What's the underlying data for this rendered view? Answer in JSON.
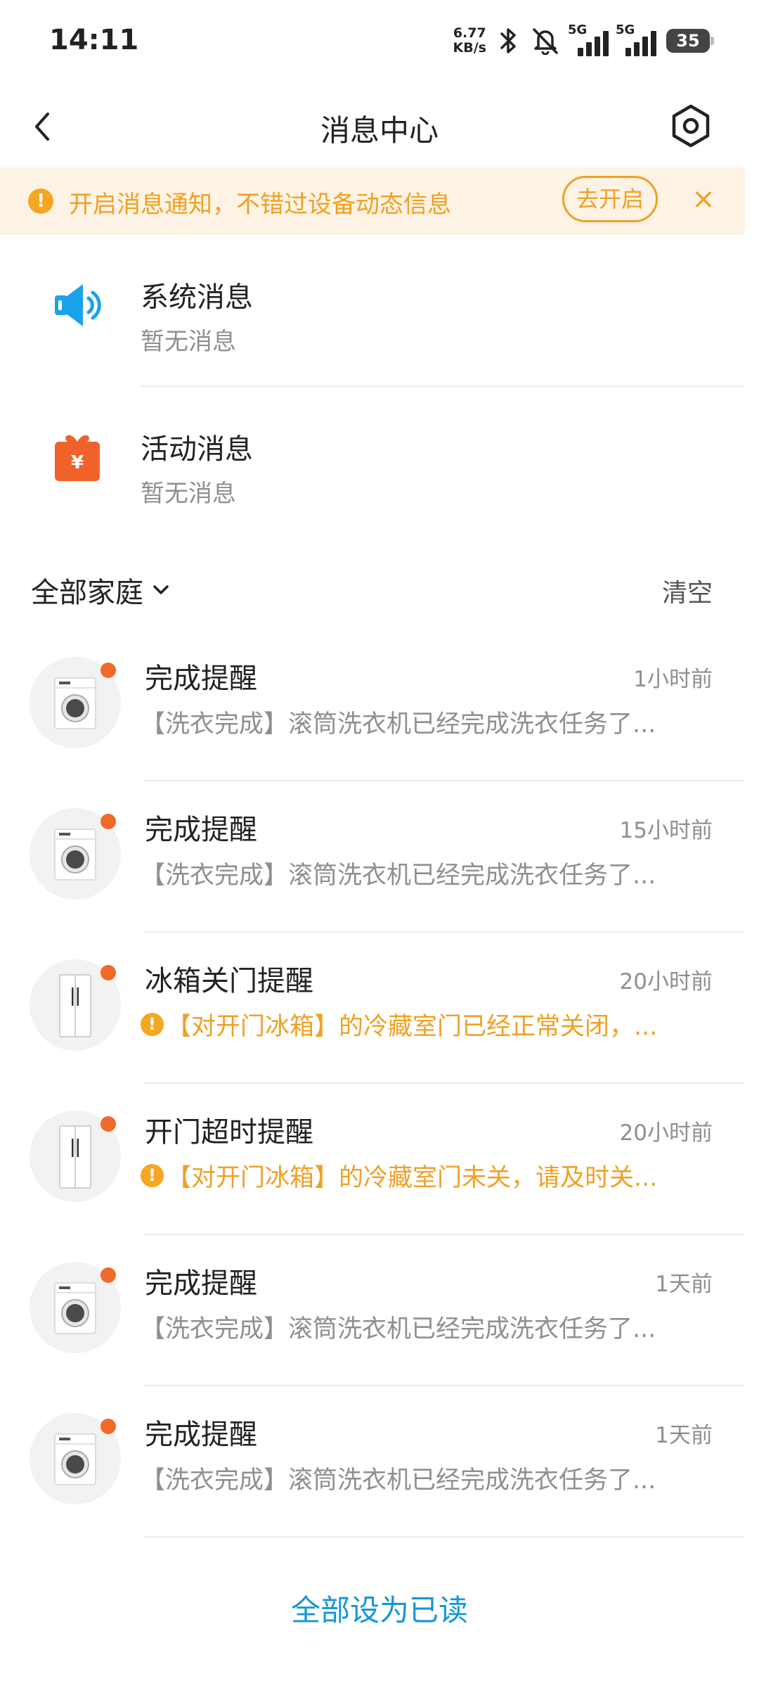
{
  "status_bar": {
    "time": "14:11",
    "net_speed_value": "6.77",
    "net_speed_unit": "KB/s",
    "sim1": "5G",
    "sim2": "5G",
    "battery": "35"
  },
  "header": {
    "title": "消息中心",
    "back_icon": "chevron-left-icon",
    "settings_icon": "hexagon-gear-icon"
  },
  "notify_banner": {
    "text": "开启消息通知，不错过设备动态信息",
    "enable_label": "去开启",
    "close_label": "×",
    "accent": "#f0a024",
    "background": "#fdf3e4"
  },
  "categories": [
    {
      "title": "系统消息",
      "subtitle": "暂无消息",
      "icon": "speaker-icon"
    },
    {
      "title": "活动消息",
      "subtitle": "暂无消息",
      "icon": "gift-icon",
      "icon_text": "¥"
    }
  ],
  "filter": {
    "family_label": "全部家庭",
    "clear_label": "清空"
  },
  "messages": [
    {
      "title": "完成提醒",
      "time": "1小时前",
      "preview": "【洗衣完成】滚筒洗衣机已经完成洗衣任务了...",
      "device": "washing-machine-icon",
      "unread": true,
      "warning": false
    },
    {
      "title": "完成提醒",
      "time": "15小时前",
      "preview": "【洗衣完成】滚筒洗衣机已经完成洗衣任务了...",
      "device": "washing-machine-icon",
      "unread": true,
      "warning": false
    },
    {
      "title": "冰箱关门提醒",
      "time": "20小时前",
      "preview": "【对开门冰箱】的冷藏室门已经正常关闭，...",
      "device": "fridge-icon",
      "unread": true,
      "warning": true
    },
    {
      "title": "开门超时提醒",
      "time": "20小时前",
      "preview": "【对开门冰箱】的冷藏室门未关，请及时关...",
      "device": "fridge-icon",
      "unread": true,
      "warning": true
    },
    {
      "title": "完成提醒",
      "time": "1天前",
      "preview": "【洗衣完成】滚筒洗衣机已经完成洗衣任务了...",
      "device": "washing-machine-icon",
      "unread": true,
      "warning": false
    },
    {
      "title": "完成提醒",
      "time": "1天前",
      "preview": "【洗衣完成】滚筒洗衣机已经完成洗衣任务了...",
      "device": "washing-machine-icon",
      "unread": true,
      "warning": false
    }
  ],
  "footer": {
    "mark_all_read_label": "全部设为已读",
    "link_color": "#1596d6"
  }
}
